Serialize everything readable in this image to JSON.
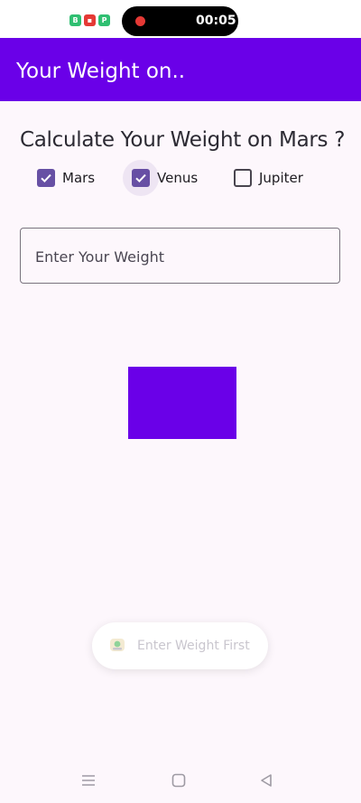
{
  "status_bar": {
    "time": "00:05",
    "apps": [
      {
        "icon": "b-app-icon",
        "letter": "B",
        "color": "#2fbf71"
      },
      {
        "icon": "video-app-icon",
        "letter": "▪",
        "color": "#e53935"
      },
      {
        "icon": "p-app-icon",
        "letter": "P",
        "color": "#2fbf71"
      }
    ]
  },
  "app_bar": {
    "title": "Your Weight on.."
  },
  "main": {
    "heading": "Calculate Your Weight on Mars ?",
    "planets": [
      {
        "label": "Mars",
        "checked": true
      },
      {
        "label": "Venus",
        "checked": true
      },
      {
        "label": "Jupiter",
        "checked": false
      }
    ],
    "weight_input": {
      "placeholder": "Enter Your Weight",
      "value": ""
    }
  },
  "toast": {
    "text": "Enter Weight First",
    "icon": "app-logo-icon"
  },
  "nav_bar": {
    "icons": [
      "menu-icon",
      "home-icon",
      "back-icon"
    ]
  },
  "colors": {
    "primary": "#6a00e8",
    "checkbox": "#6750a4",
    "background": "#fdf7fc"
  }
}
